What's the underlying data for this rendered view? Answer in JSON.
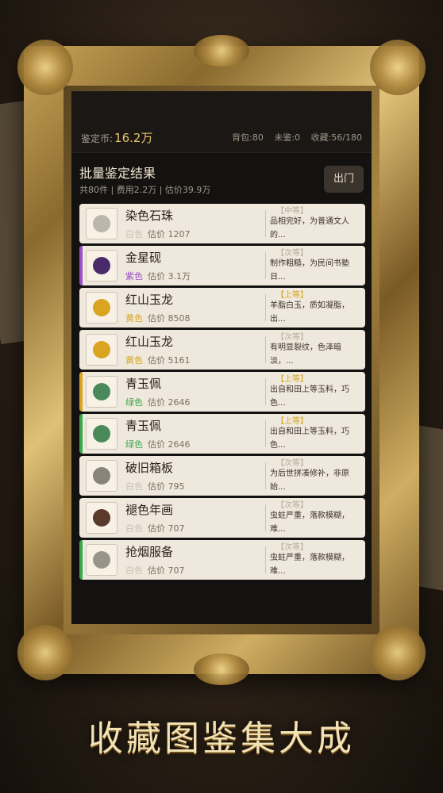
{
  "topbar": {
    "coin_label": "鉴定币:",
    "coin_value": "16.2万",
    "bag": "背包:80",
    "unappraised": "未鉴:0",
    "collection": "收藏:56/180"
  },
  "result": {
    "title": "批量鉴定结果",
    "summary": "共80件 | 费用2.2万 | 估价39.9万",
    "exit_label": "出门"
  },
  "items": [
    {
      "name": "染色石珠",
      "quality": "白色",
      "price": "估价 1207",
      "grade": "【中等】",
      "desc": "品相完好，为普通文人的...",
      "qcolor": "#c9c2b5",
      "gcolor": "#b8ad9c",
      "stripe": "",
      "icon": "bead-icon",
      "tint": "#bdb6aa"
    },
    {
      "name": "金星砚",
      "quality": "紫色",
      "price": "估价 3.1万",
      "grade": "【次等】",
      "desc": "制作粗糙，为民间书塾日...",
      "qcolor": "#9b4fc9",
      "gcolor": "#b8ad9c",
      "stripe": "#9b4fc9",
      "icon": "inkstone-icon",
      "tint": "#4a2a6a"
    },
    {
      "name": "红山玉龙",
      "quality": "黄色",
      "price": "估价 8508",
      "grade": "【上等】",
      "desc": "羊脂白玉，质如凝脂，出...",
      "qcolor": "#d9a520",
      "gcolor": "#d9a520",
      "stripe": "",
      "icon": "jade-dragon-icon",
      "tint": "#d9a520"
    },
    {
      "name": "红山玉龙",
      "quality": "黄色",
      "price": "估价 5161",
      "grade": "【次等】",
      "desc": "有明显裂纹，色泽暗淡，...",
      "qcolor": "#d9a520",
      "gcolor": "#b8ad9c",
      "stripe": "",
      "icon": "jade-dragon-icon",
      "tint": "#d9a520"
    },
    {
      "name": "青玉佩",
      "quality": "绿色",
      "price": "估价 2646",
      "grade": "【上等】",
      "desc": "出自和田上等玉料，巧色...",
      "qcolor": "#3aa84a",
      "gcolor": "#d9a520",
      "stripe": "#d9a520",
      "icon": "jade-pendant-icon",
      "tint": "#4a8a5a"
    },
    {
      "name": "青玉佩",
      "quality": "绿色",
      "price": "估价 2646",
      "grade": "【上等】",
      "desc": "出自和田上等玉料，巧色...",
      "qcolor": "#3aa84a",
      "gcolor": "#d9a520",
      "stripe": "#3aa84a",
      "icon": "jade-pendant-icon",
      "tint": "#4a8a5a"
    },
    {
      "name": "破旧箱板",
      "quality": "白色",
      "price": "估价 795",
      "grade": "【次等】",
      "desc": "为后世拼凑修补，非原始...",
      "qcolor": "#c9c2b5",
      "gcolor": "#b8ad9c",
      "stripe": "",
      "icon": "crate-icon",
      "tint": "#8a8478"
    },
    {
      "name": "褪色年画",
      "quality": "白色",
      "price": "估价 707",
      "grade": "【次等】",
      "desc": "虫蛀严重，落款模糊，难...",
      "qcolor": "#c9c2b5",
      "gcolor": "#b8ad9c",
      "stripe": "",
      "icon": "painting-icon",
      "tint": "#5a3a2a"
    },
    {
      "name": "抢烟服备",
      "quality": "白色",
      "price": "估价 707",
      "grade": "【次等】",
      "desc": "虫蛀严重，落款模糊，难...",
      "qcolor": "#c9c2b5",
      "gcolor": "#b8ad9c",
      "stripe": "#3aa84a",
      "icon": "amulet-icon",
      "tint": "#9a9488"
    }
  ],
  "slogan": "收藏图鉴集大成"
}
